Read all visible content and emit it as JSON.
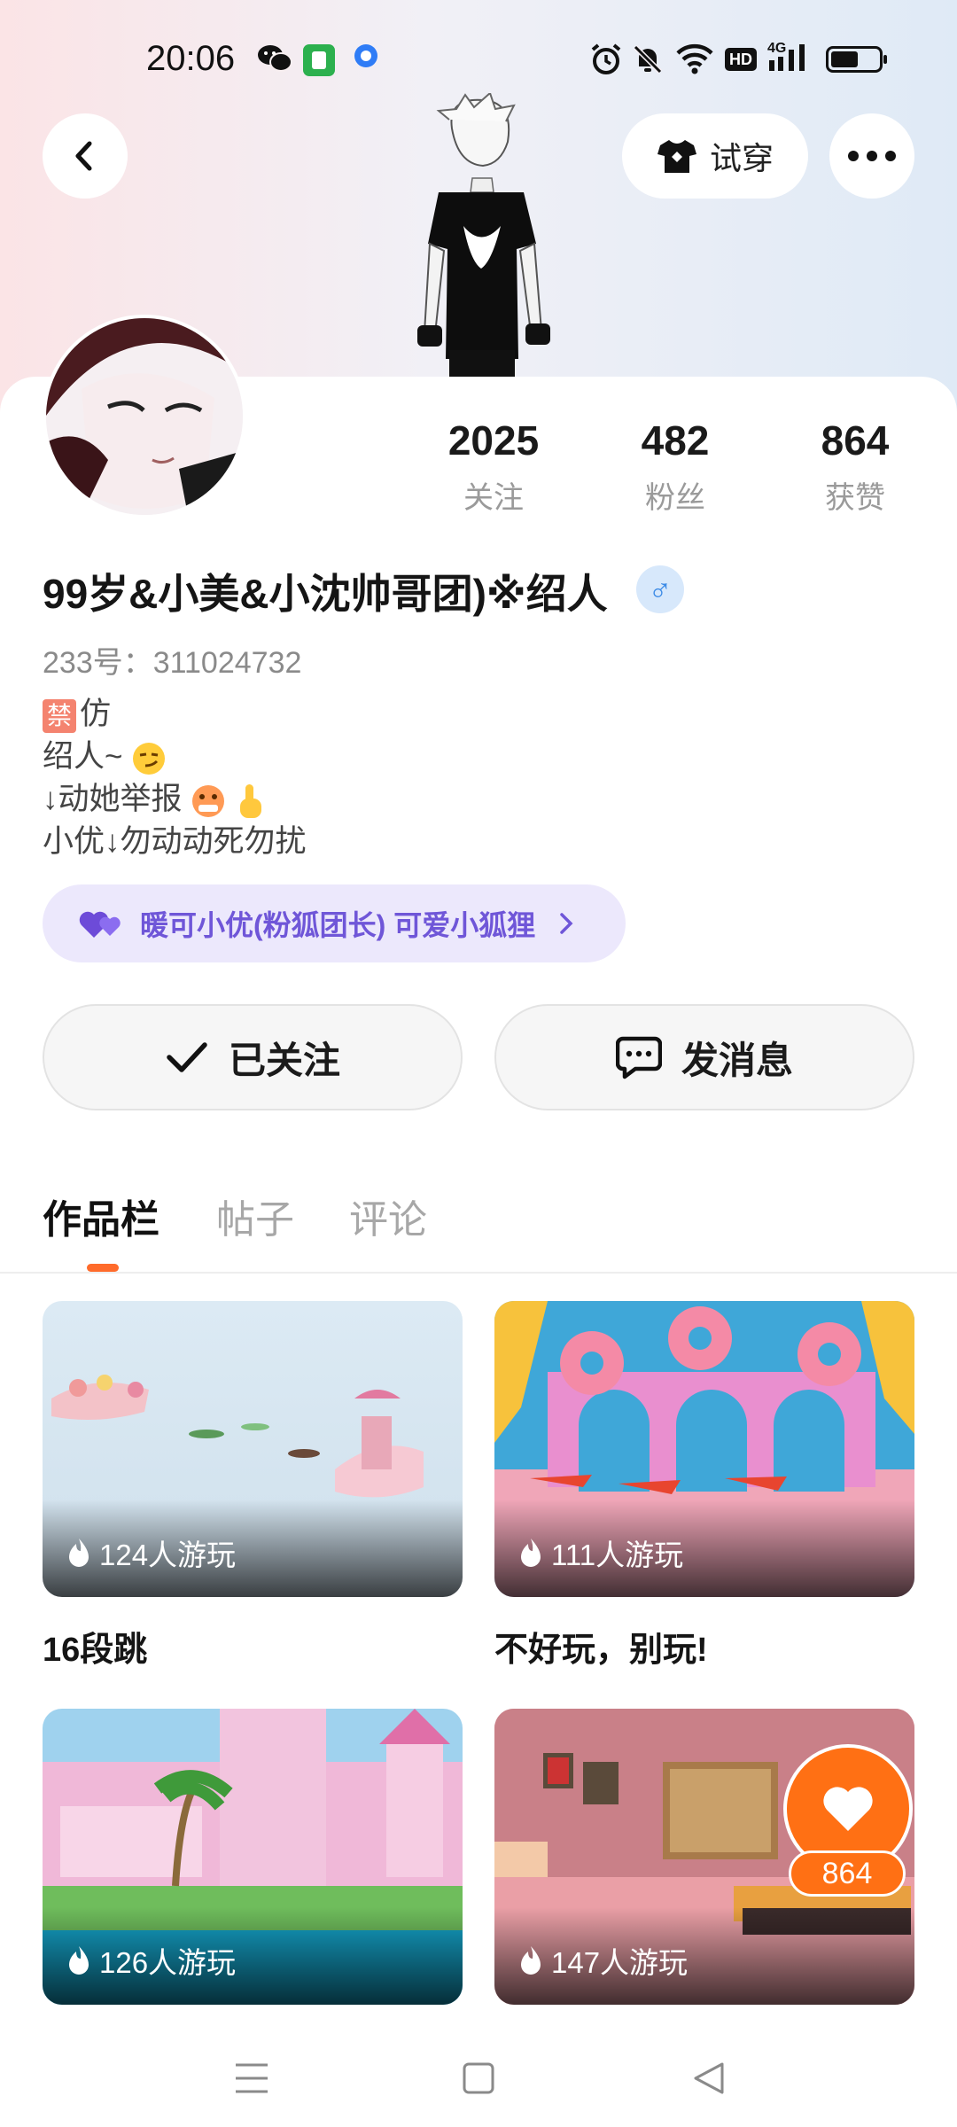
{
  "status_bar": {
    "time": "20:06",
    "left_icons": [
      "wechat-icon",
      "app-icon",
      "qq-browser-icon"
    ],
    "right_icons": [
      "alarm-icon",
      "mute-icon",
      "wifi-icon",
      "hd-icon",
      "signal-4g-icon",
      "battery-icon"
    ],
    "hd_label": "HD",
    "network_label": "4G"
  },
  "header": {
    "tryon_label": "试穿"
  },
  "profile": {
    "stats": [
      {
        "value": "2025",
        "label": "关注"
      },
      {
        "value": "482",
        "label": "粉丝"
      },
      {
        "value": "864",
        "label": "获赞"
      }
    ],
    "name": "99岁&小美&小沈帅哥团)※绍人",
    "gender_symbol": "♂",
    "uid": "233号：311024732",
    "bio": {
      "ban_tag": "禁",
      "line1_text": "仿",
      "line2_text": "绍人~",
      "line3_text": "↓动她举报",
      "line4_text": "小优↓勿动动死勿扰"
    },
    "relation_text": "暖可小优(粉狐团长) 可爱小狐狸"
  },
  "actions": {
    "follow_label": "已关注",
    "message_label": "发消息"
  },
  "tabs": [
    {
      "label": "作品栏",
      "active": true
    },
    {
      "label": "帖子",
      "active": false
    },
    {
      "label": "评论",
      "active": false
    }
  ],
  "works": [
    {
      "plays": "124人游玩",
      "title": "16段跳"
    },
    {
      "plays": "111人游玩",
      "title": "不好玩，别玩!"
    },
    {
      "plays": "126人游玩",
      "title": ""
    },
    {
      "plays": "147人游玩",
      "title": ""
    }
  ],
  "like_float": {
    "count": "864"
  },
  "colors": {
    "accent": "#ff6b2b",
    "like": "#ff7014",
    "relation_bg": "#ece8fc",
    "relation_text": "#6f56d8",
    "gender_bg": "#d7e8fb"
  }
}
